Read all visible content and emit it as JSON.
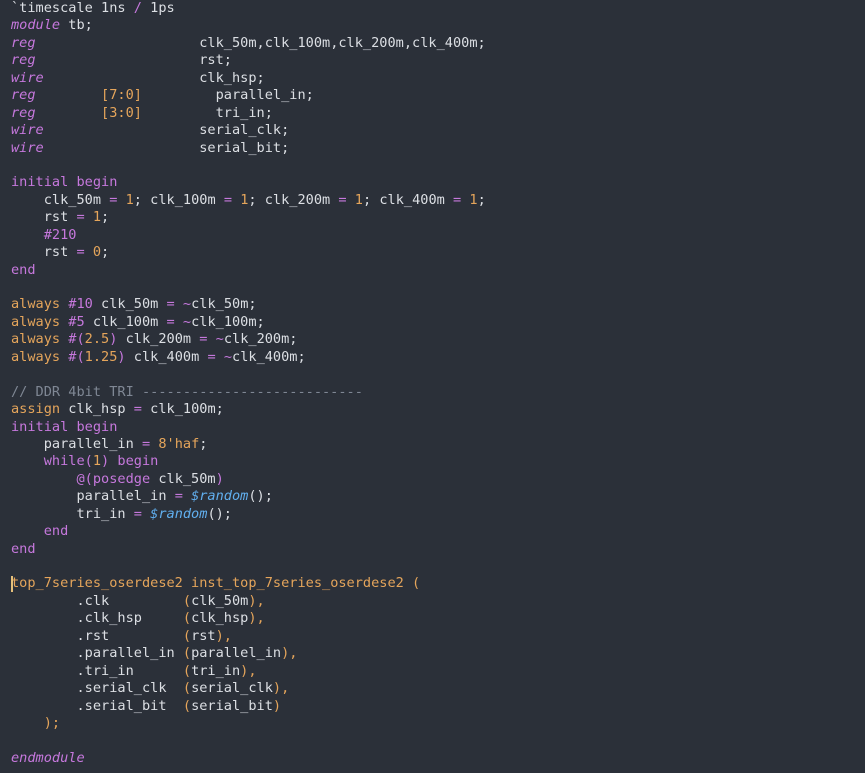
{
  "editor": {
    "language": "verilog",
    "cursor_line": 33,
    "lines": [
      [
        {
          "t": "`timescale 1ns ",
          "c": "tok-ident"
        },
        {
          "t": "/",
          "c": "tok-op"
        },
        {
          "t": " 1ps",
          "c": "tok-ident"
        }
      ],
      [
        {
          "t": "module",
          "c": "tok-kwi"
        },
        {
          "t": " tb;",
          "c": "tok-ident"
        }
      ],
      [
        {
          "t": "reg",
          "c": "tok-type"
        },
        {
          "t": "                    clk_50m,clk_100m,clk_200m,clk_400m;",
          "c": "tok-ident"
        }
      ],
      [
        {
          "t": "reg",
          "c": "tok-type"
        },
        {
          "t": "                    rst;",
          "c": "tok-ident"
        }
      ],
      [
        {
          "t": "wire",
          "c": "tok-type"
        },
        {
          "t": "                   clk_hsp;",
          "c": "tok-ident"
        }
      ],
      [
        {
          "t": "reg",
          "c": "tok-type"
        },
        {
          "t": "        ",
          "c": "tok-ident"
        },
        {
          "t": "[7:0]",
          "c": "tok-num"
        },
        {
          "t": "         parallel_in;",
          "c": "tok-ident"
        }
      ],
      [
        {
          "t": "reg",
          "c": "tok-type"
        },
        {
          "t": "        ",
          "c": "tok-ident"
        },
        {
          "t": "[3:0]",
          "c": "tok-num"
        },
        {
          "t": "         tri_in;",
          "c": "tok-ident"
        }
      ],
      [
        {
          "t": "wire",
          "c": "tok-type"
        },
        {
          "t": "                   serial_clk;",
          "c": "tok-ident"
        }
      ],
      [
        {
          "t": "wire",
          "c": "tok-type"
        },
        {
          "t": "                   serial_bit;",
          "c": "tok-ident"
        }
      ],
      [],
      [
        {
          "t": "initial begin",
          "c": "tok-kw"
        }
      ],
      [
        {
          "t": "    clk_50m ",
          "c": "tok-ident"
        },
        {
          "t": "=",
          "c": "tok-op"
        },
        {
          "t": " ",
          "c": "tok-ident"
        },
        {
          "t": "1",
          "c": "tok-num"
        },
        {
          "t": "; clk_100m ",
          "c": "tok-ident"
        },
        {
          "t": "=",
          "c": "tok-op"
        },
        {
          "t": " ",
          "c": "tok-ident"
        },
        {
          "t": "1",
          "c": "tok-num"
        },
        {
          "t": "; clk_200m ",
          "c": "tok-ident"
        },
        {
          "t": "=",
          "c": "tok-op"
        },
        {
          "t": " ",
          "c": "tok-ident"
        },
        {
          "t": "1",
          "c": "tok-num"
        },
        {
          "t": "; clk_400m ",
          "c": "tok-ident"
        },
        {
          "t": "=",
          "c": "tok-op"
        },
        {
          "t": " ",
          "c": "tok-ident"
        },
        {
          "t": "1",
          "c": "tok-num"
        },
        {
          "t": ";",
          "c": "tok-ident"
        }
      ],
      [
        {
          "t": "    rst ",
          "c": "tok-ident"
        },
        {
          "t": "=",
          "c": "tok-op"
        },
        {
          "t": " ",
          "c": "tok-ident"
        },
        {
          "t": "1",
          "c": "tok-num"
        },
        {
          "t": ";",
          "c": "tok-ident"
        }
      ],
      [
        {
          "t": "    #210",
          "c": "tok-kw"
        }
      ],
      [
        {
          "t": "    rst ",
          "c": "tok-ident"
        },
        {
          "t": "=",
          "c": "tok-op"
        },
        {
          "t": " ",
          "c": "tok-ident"
        },
        {
          "t": "0",
          "c": "tok-num"
        },
        {
          "t": ";",
          "c": "tok-ident"
        }
      ],
      [
        {
          "t": "end",
          "c": "tok-kw"
        }
      ],
      [],
      [
        {
          "t": "always",
          "c": "tok-mod"
        },
        {
          "t": " ",
          "c": "tok-ident"
        },
        {
          "t": "#10",
          "c": "tok-kw"
        },
        {
          "t": " clk_50m ",
          "c": "tok-ident"
        },
        {
          "t": "=",
          "c": "tok-op"
        },
        {
          "t": " ",
          "c": "tok-ident"
        },
        {
          "t": "~",
          "c": "tok-op"
        },
        {
          "t": "clk_50m;",
          "c": "tok-ident"
        }
      ],
      [
        {
          "t": "always",
          "c": "tok-mod"
        },
        {
          "t": " ",
          "c": "tok-ident"
        },
        {
          "t": "#5",
          "c": "tok-kw"
        },
        {
          "t": " clk_100m ",
          "c": "tok-ident"
        },
        {
          "t": "=",
          "c": "tok-op"
        },
        {
          "t": " ",
          "c": "tok-ident"
        },
        {
          "t": "~",
          "c": "tok-op"
        },
        {
          "t": "clk_100m;",
          "c": "tok-ident"
        }
      ],
      [
        {
          "t": "always",
          "c": "tok-mod"
        },
        {
          "t": " ",
          "c": "tok-ident"
        },
        {
          "t": "#(",
          "c": "tok-kw"
        },
        {
          "t": "2.5",
          "c": "tok-num"
        },
        {
          "t": ")",
          "c": "tok-kw"
        },
        {
          "t": " clk_200m ",
          "c": "tok-ident"
        },
        {
          "t": "=",
          "c": "tok-op"
        },
        {
          "t": " ",
          "c": "tok-ident"
        },
        {
          "t": "~",
          "c": "tok-op"
        },
        {
          "t": "clk_200m;",
          "c": "tok-ident"
        }
      ],
      [
        {
          "t": "always",
          "c": "tok-mod"
        },
        {
          "t": " ",
          "c": "tok-ident"
        },
        {
          "t": "#(",
          "c": "tok-kw"
        },
        {
          "t": "1.25",
          "c": "tok-num"
        },
        {
          "t": ")",
          "c": "tok-kw"
        },
        {
          "t": " clk_400m ",
          "c": "tok-ident"
        },
        {
          "t": "=",
          "c": "tok-op"
        },
        {
          "t": " ",
          "c": "tok-ident"
        },
        {
          "t": "~",
          "c": "tok-op"
        },
        {
          "t": "clk_400m;",
          "c": "tok-ident"
        }
      ],
      [],
      [
        {
          "t": "// DDR 4bit TRI ---------------------------",
          "c": "tok-cmt"
        }
      ],
      [
        {
          "t": "assign",
          "c": "tok-mod"
        },
        {
          "t": " clk_hsp ",
          "c": "tok-ident"
        },
        {
          "t": "=",
          "c": "tok-op"
        },
        {
          "t": " clk_100m;",
          "c": "tok-ident"
        }
      ],
      [
        {
          "t": "initial begin",
          "c": "tok-kw"
        }
      ],
      [
        {
          "t": "    parallel_in ",
          "c": "tok-ident"
        },
        {
          "t": "=",
          "c": "tok-op"
        },
        {
          "t": " ",
          "c": "tok-ident"
        },
        {
          "t": "8'haf",
          "c": "tok-num"
        },
        {
          "t": ";",
          "c": "tok-ident"
        }
      ],
      [
        {
          "t": "    while(",
          "c": "tok-kw"
        },
        {
          "t": "1",
          "c": "tok-num"
        },
        {
          "t": ") begin",
          "c": "tok-kw"
        }
      ],
      [
        {
          "t": "        @(posedge",
          "c": "tok-kw"
        },
        {
          "t": " clk_50m",
          "c": "tok-ident"
        },
        {
          "t": ")",
          "c": "tok-kw"
        }
      ],
      [
        {
          "t": "        parallel_in ",
          "c": "tok-ident"
        },
        {
          "t": "=",
          "c": "tok-op"
        },
        {
          "t": " ",
          "c": "tok-ident"
        },
        {
          "t": "$random",
          "c": "tok-fn"
        },
        {
          "t": "();",
          "c": "tok-ident"
        }
      ],
      [
        {
          "t": "        tri_in ",
          "c": "tok-ident"
        },
        {
          "t": "=",
          "c": "tok-op"
        },
        {
          "t": " ",
          "c": "tok-ident"
        },
        {
          "t": "$random",
          "c": "tok-fn"
        },
        {
          "t": "();",
          "c": "tok-ident"
        }
      ],
      [
        {
          "t": "    end",
          "c": "tok-kw"
        }
      ],
      [
        {
          "t": "end",
          "c": "tok-kw"
        }
      ],
      [],
      [
        {
          "t": "top_7series_oserdese2",
          "c": "tok-mod"
        },
        {
          "t": " inst_top_7series_oserdese2 ",
          "c": "tok-mod"
        },
        {
          "t": "(",
          "c": "tok-paren"
        }
      ],
      [
        {
          "t": "        .clk         ",
          "c": "tok-ident"
        },
        {
          "t": "(",
          "c": "tok-paren"
        },
        {
          "t": "clk_50m",
          "c": "tok-ident"
        },
        {
          "t": "),",
          "c": "tok-paren"
        }
      ],
      [
        {
          "t": "        .clk_hsp     ",
          "c": "tok-ident"
        },
        {
          "t": "(",
          "c": "tok-paren"
        },
        {
          "t": "clk_hsp",
          "c": "tok-ident"
        },
        {
          "t": "),",
          "c": "tok-paren"
        }
      ],
      [
        {
          "t": "        .rst         ",
          "c": "tok-ident"
        },
        {
          "t": "(",
          "c": "tok-paren"
        },
        {
          "t": "rst",
          "c": "tok-ident"
        },
        {
          "t": "),",
          "c": "tok-paren"
        }
      ],
      [
        {
          "t": "        .parallel_in ",
          "c": "tok-ident"
        },
        {
          "t": "(",
          "c": "tok-paren"
        },
        {
          "t": "parallel_in",
          "c": "tok-ident"
        },
        {
          "t": "),",
          "c": "tok-paren"
        }
      ],
      [
        {
          "t": "        .tri_in      ",
          "c": "tok-ident"
        },
        {
          "t": "(",
          "c": "tok-paren"
        },
        {
          "t": "tri_in",
          "c": "tok-ident"
        },
        {
          "t": "),",
          "c": "tok-paren"
        }
      ],
      [
        {
          "t": "        .serial_clk  ",
          "c": "tok-ident"
        },
        {
          "t": "(",
          "c": "tok-paren"
        },
        {
          "t": "serial_clk",
          "c": "tok-ident"
        },
        {
          "t": "),",
          "c": "tok-paren"
        }
      ],
      [
        {
          "t": "        .serial_bit  ",
          "c": "tok-ident"
        },
        {
          "t": "(",
          "c": "tok-paren"
        },
        {
          "t": "serial_bit",
          "c": "tok-ident"
        },
        {
          "t": ")",
          "c": "tok-paren"
        }
      ],
      [
        {
          "t": "    );",
          "c": "tok-paren"
        }
      ],
      [],
      [
        {
          "t": "endmodule",
          "c": "tok-kwi"
        }
      ]
    ]
  }
}
